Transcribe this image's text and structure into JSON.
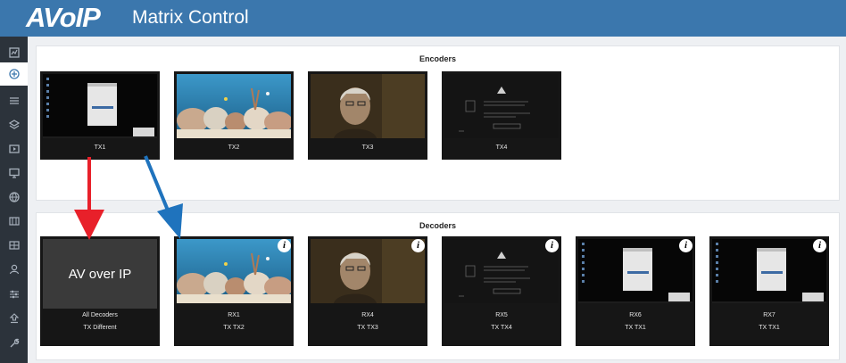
{
  "header": {
    "logo": "AVoIP",
    "title": "Matrix Control"
  },
  "sidebar": {
    "icons": [
      "dashboard-icon",
      "matrix-icon",
      "list-icon",
      "layers-icon",
      "video-icon",
      "monitor-icon",
      "globe-icon",
      "rows-icon",
      "grid-icon",
      "user-icon",
      "sliders-icon",
      "upload-icon",
      "wrench-icon"
    ],
    "active_index": 1
  },
  "encoders": {
    "title": "Encoders",
    "tiles": [
      {
        "label": "TX1",
        "thumb": "desktop"
      },
      {
        "label": "TX2",
        "thumb": "aquarium"
      },
      {
        "label": "TX3",
        "thumb": "person"
      },
      {
        "label": "TX4",
        "thumb": "nosignal"
      }
    ]
  },
  "decoders": {
    "title": "Decoders",
    "tiles": [
      {
        "label": "All Decoders",
        "source": "TX Different",
        "thumb": "av",
        "av_text": "AV over IP",
        "info": false
      },
      {
        "label": "RX1",
        "source": "TX TX2",
        "thumb": "aquarium",
        "info": true
      },
      {
        "label": "RX4",
        "source": "TX TX3",
        "thumb": "person",
        "info": true
      },
      {
        "label": "RX5",
        "source": "TX TX4",
        "thumb": "nosignal",
        "info": true
      },
      {
        "label": "RX6",
        "source": "TX TX1",
        "thumb": "desktop",
        "info": true
      },
      {
        "label": "RX7",
        "source": "TX TX1",
        "thumb": "desktop",
        "info": true
      }
    ]
  },
  "info_glyph": "i",
  "colors": {
    "header": "#3b77ad",
    "sidebar": "#2c333b",
    "arrow_red": "#e8202a",
    "arrow_blue": "#1f73bd"
  }
}
